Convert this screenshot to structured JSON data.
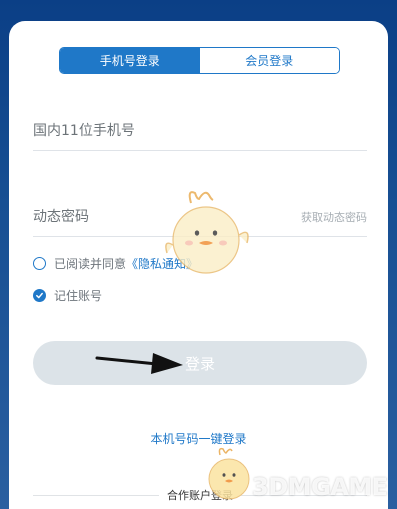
{
  "tabs": {
    "phone_login": "手机号登录",
    "member_login": "会员登录"
  },
  "form": {
    "phone_placeholder": "国内11位手机号",
    "code_placeholder": "动态密码",
    "get_code": "获取动态密码"
  },
  "agreement": {
    "prefix": "已阅读并同意",
    "link": "《隐私通知》"
  },
  "remember": {
    "label": "记住账号"
  },
  "login_button": "登录",
  "one_key_login": "本机号码一键登录",
  "other_login": "合作账户登录",
  "watermark": "3DMGAME",
  "colors": {
    "accent": "#1f78c8",
    "background": "#174f93",
    "disabled_button": "#dce3e8"
  }
}
